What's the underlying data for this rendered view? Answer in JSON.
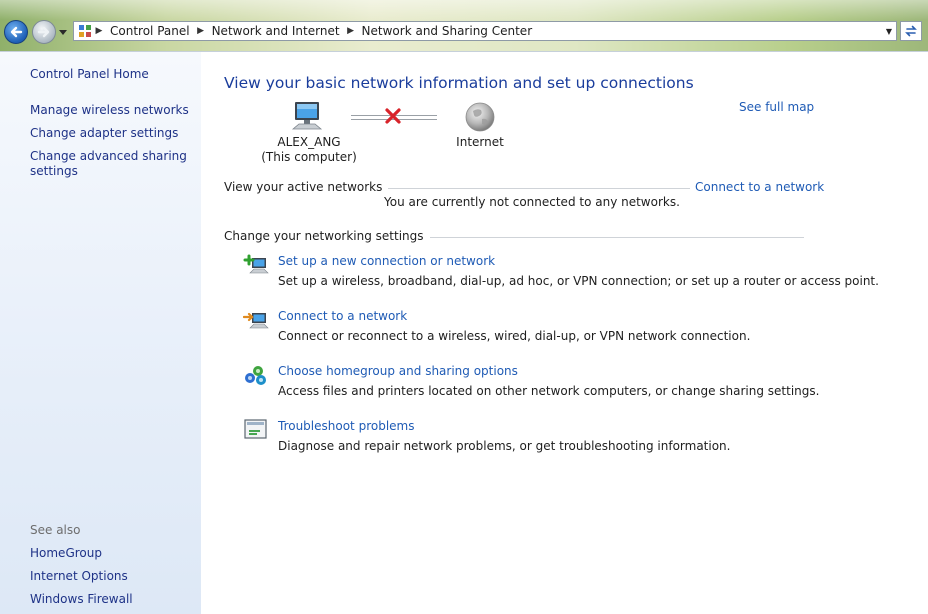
{
  "nav": {
    "back_icon": "back-arrow-icon",
    "forward_icon": "forward-arrow-icon",
    "breadcrumb": [
      "Control Panel",
      "Network and Internet",
      "Network and Sharing Center"
    ]
  },
  "sidebar": {
    "home": "Control Panel Home",
    "links": [
      "Manage wireless networks",
      "Change adapter settings",
      "Change advanced sharing",
      "settings"
    ],
    "see_also_label": "See also",
    "see_also": [
      "HomeGroup",
      "Internet Options",
      "Windows Firewall"
    ]
  },
  "main": {
    "title": "View your basic network information and set up connections",
    "see_full_map": "See full map",
    "computer_name": "ALEX_ANG",
    "computer_sub": "(This computer)",
    "internet_label": "Internet",
    "active_networks_label": "View your active networks",
    "connect_link": "Connect to a network",
    "not_connected": "You are currently not connected to any networks.",
    "change_settings_label": "Change your networking settings",
    "tasks": [
      {
        "title": "Set up a new connection or network",
        "desc": "Set up a wireless, broadband, dial-up, ad hoc, or VPN connection; or set up a router or access point."
      },
      {
        "title": "Connect to a network",
        "desc": "Connect or reconnect to a wireless, wired, dial-up, or VPN network connection."
      },
      {
        "title": "Choose homegroup and sharing options",
        "desc": "Access files and printers located on other network computers, or change sharing settings."
      },
      {
        "title": "Troubleshoot problems",
        "desc": "Diagnose and repair network problems, or get troubleshooting information."
      }
    ]
  },
  "colors": {
    "link": "#1f5bb5",
    "title": "#1a3d9c",
    "sidebar_bg": "#e6eef9",
    "disconnect_x": "#d8232a"
  }
}
